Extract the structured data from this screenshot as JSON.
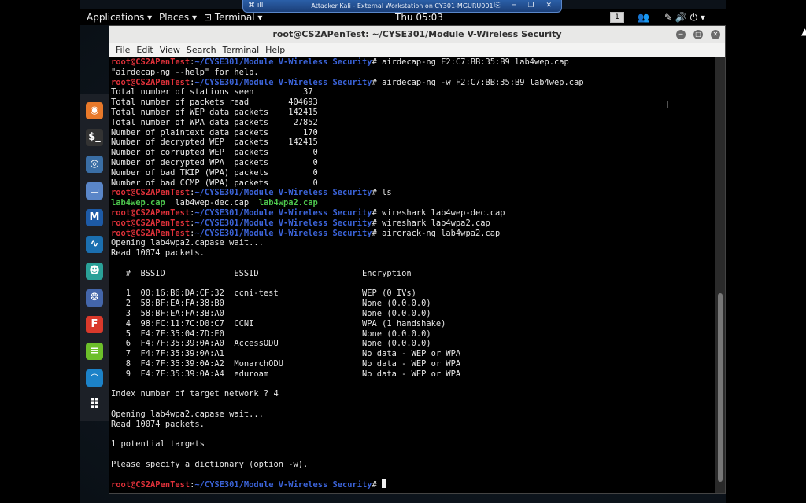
{
  "vm": {
    "title": "Attacker Kali - External Workstation on CY301-MGURU001",
    "icons_left": "⌘ ıll",
    "icons_right": "⎘ ─ ❐ ✕"
  },
  "panel": {
    "applications": "Applications ▾",
    "places": "Places ▾",
    "terminal": "⊡ Terminal ▾",
    "clock": "Thu 05:03",
    "workspace": "1",
    "status_icons": "✎ 🔊 ⏻ ▾"
  },
  "terminal": {
    "title": "root@CS2APenTest: ~/CYSE301/Module V-Wireless Security",
    "menu": [
      "File",
      "Edit",
      "View",
      "Search",
      "Terminal",
      "Help"
    ],
    "prompt_user": "root@CS2APenTest",
    "prompt_path": "~/CYSE301/Module V-Wireless Security"
  },
  "lines": [
    {
      "type": "cmd",
      "text": "airdecap-ng F2:C7:BB:35:B9 lab4wep.cap"
    },
    {
      "type": "out",
      "text": "\"airdecap-ng --help\" for help."
    },
    {
      "type": "cmd",
      "text": "airdecap-ng -w F2:C7:BB:35:B9 lab4wep.cap"
    },
    {
      "type": "out",
      "text": "Total number of stations seen          37"
    },
    {
      "type": "out",
      "text": "Total number of packets read        404693"
    },
    {
      "type": "out",
      "text": "Total number of WEP data packets    142415"
    },
    {
      "type": "out",
      "text": "Total number of WPA data packets     27852"
    },
    {
      "type": "out",
      "text": "Number of plaintext data packets       170"
    },
    {
      "type": "out",
      "text": "Number of decrypted WEP  packets    142415"
    },
    {
      "type": "out",
      "text": "Number of corrupted WEP  packets         0"
    },
    {
      "type": "out",
      "text": "Number of decrypted WPA  packets         0"
    },
    {
      "type": "out",
      "text": "Number of bad TKIP (WPA) packets         0"
    },
    {
      "type": "out",
      "text": "Number of bad CCMP (WPA) packets         0"
    },
    {
      "type": "cmd",
      "text": "ls"
    },
    {
      "type": "files",
      "files": [
        {
          "name": "lab4wep.cap",
          "color": "green"
        },
        {
          "name": "lab4wep-dec.cap",
          "color": "plain"
        },
        {
          "name": "lab4wpa2.cap",
          "color": "green"
        }
      ]
    },
    {
      "type": "cmd",
      "text": "wireshark lab4wep-dec.cap"
    },
    {
      "type": "cmd",
      "text": "wireshark lab4wpa2.cap"
    },
    {
      "type": "cmd",
      "text": "aircrack-ng lab4wpa2.cap"
    },
    {
      "type": "out",
      "text": "Opening lab4wpa2.capase wait..."
    },
    {
      "type": "out",
      "text": "Read 10074 packets."
    },
    {
      "type": "out",
      "text": ""
    },
    {
      "type": "out",
      "text": "   #  BSSID              ESSID                     Encryption"
    },
    {
      "type": "out",
      "text": ""
    },
    {
      "type": "out",
      "text": "   1  00:16:B6:DA:CF:32  ccni-test                 WEP (0 IVs)"
    },
    {
      "type": "out",
      "text": "   2  58:BF:EA:FA:38:B0                            None (0.0.0.0)"
    },
    {
      "type": "out",
      "text": "   3  58:BF:EA:FA:3B:A0                            None (0.0.0.0)"
    },
    {
      "type": "out",
      "text": "   4  98:FC:11:7C:D0:C7  CCNI                      WPA (1 handshake)"
    },
    {
      "type": "out",
      "text": "   5  F4:7F:35:04:7D:E0                            None (0.0.0.0)"
    },
    {
      "type": "out",
      "text": "   6  F4:7F:35:39:0A:A0  AccessODU                 None (0.0.0.0)"
    },
    {
      "type": "out",
      "text": "   7  F4:7F:35:39:0A:A1                            No data - WEP or WPA"
    },
    {
      "type": "out",
      "text": "   8  F4:7F:35:39:0A:A2  MonarchODU                No data - WEP or WPA"
    },
    {
      "type": "out",
      "text": "   9  F4:7F:35:39:0A:A4  eduroam                   No data - WEP or WPA"
    },
    {
      "type": "out",
      "text": ""
    },
    {
      "type": "out",
      "text": "Index number of target network ? 4"
    },
    {
      "type": "out",
      "text": ""
    },
    {
      "type": "out",
      "text": "Opening lab4wpa2.capase wait..."
    },
    {
      "type": "out",
      "text": "Read 10074 packets."
    },
    {
      "type": "out",
      "text": ""
    },
    {
      "type": "out",
      "text": "1 potential targets"
    },
    {
      "type": "out",
      "text": ""
    },
    {
      "type": "out",
      "text": "Please specify a dictionary (option -w)."
    },
    {
      "type": "out",
      "text": ""
    },
    {
      "type": "prompt",
      "text": ""
    }
  ],
  "dock": [
    {
      "name": "firefox-icon",
      "glyph": "◉",
      "color": "#e8792a"
    },
    {
      "name": "terminal-icon",
      "glyph": "$_",
      "color": "#333333"
    },
    {
      "name": "eye-icon",
      "glyph": "◎",
      "color": "#3a6ea5"
    },
    {
      "name": "files-icon",
      "glyph": "▭",
      "color": "#5a86c8"
    },
    {
      "name": "metasploit-icon",
      "glyph": "M",
      "color": "#1d5aa6"
    },
    {
      "name": "wave-icon",
      "glyph": "∿",
      "color": "#1b6fb0"
    },
    {
      "name": "face-icon",
      "glyph": "☻",
      "color": "#2aa198"
    },
    {
      "name": "dots-icon",
      "glyph": "❂",
      "color": "#4466aa"
    },
    {
      "name": "flash-icon",
      "glyph": "F",
      "color": "#d9392b"
    },
    {
      "name": "notes-icon",
      "glyph": "≡",
      "color": "#6cbf2a"
    },
    {
      "name": "shark-icon",
      "glyph": "◠",
      "color": "#1c82c8"
    },
    {
      "name": "app-grid-icon",
      "glyph": "⠿",
      "color": "transparent"
    }
  ]
}
